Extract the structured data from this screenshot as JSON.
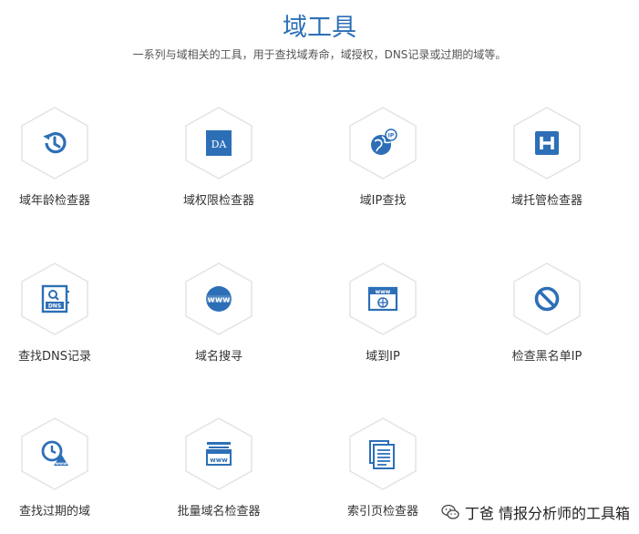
{
  "header": {
    "title": "域工具",
    "subtitle": "一系列与域相关的工具，用于查找域寿命，域授权，DNS记录或过期的域等。"
  },
  "colors": {
    "accent": "#2d6fb7",
    "hex_border": "#e3e3e3"
  },
  "tools": [
    {
      "label": "域年龄检查器",
      "icon": "history-icon"
    },
    {
      "label": "域权限检查器",
      "icon": "da-badge-icon"
    },
    {
      "label": "域IP查找",
      "icon": "globe-ip-icon"
    },
    {
      "label": "域托管检查器",
      "icon": "hospital-h-icon"
    },
    {
      "label": "查找DNS记录",
      "icon": "dns-search-icon"
    },
    {
      "label": "域名搜寻",
      "icon": "www-badge-icon"
    },
    {
      "label": "域到IP",
      "icon": "www-browser-globe-icon"
    },
    {
      "label": "检查黑名单IP",
      "icon": "ban-icon"
    },
    {
      "label": "查找过期的域",
      "icon": "clock-warning-icon"
    },
    {
      "label": "批量域名检查器",
      "icon": "www-window-icon"
    },
    {
      "label": "索引页检查器",
      "icon": "index-pages-icon"
    }
  ],
  "watermark": {
    "text": "丁爸 情报分析师的工具箱",
    "icon": "wechat-icon"
  }
}
